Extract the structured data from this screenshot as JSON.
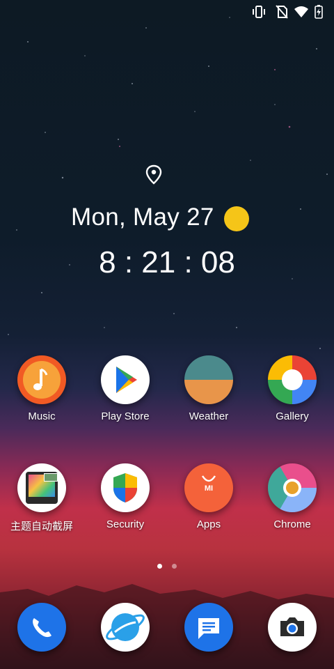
{
  "clock_widget": {
    "date": "Mon, May 27",
    "time": "8 : 21 : 08",
    "location_icon": "location-pin-icon",
    "weather_icon": "sun-icon"
  },
  "status_bar": {
    "icons": [
      "vibrate-icon",
      "no-sim-icon",
      "wifi-icon",
      "battery-charging-icon"
    ]
  },
  "apps": [
    {
      "label": "Music",
      "icon": "music-icon"
    },
    {
      "label": "Play Store",
      "icon": "play-store-icon"
    },
    {
      "label": "Weather",
      "icon": "weather-icon"
    },
    {
      "label": "Gallery",
      "icon": "gallery-icon"
    },
    {
      "label": "主题自动截屏",
      "icon": "screenshot-theme-icon"
    },
    {
      "label": "Security",
      "icon": "security-shield-icon"
    },
    {
      "label": "Apps",
      "icon": "mi-apps-icon",
      "badge_text": "MI"
    },
    {
      "label": "Chrome",
      "icon": "chrome-icon"
    }
  ],
  "page_indicator": {
    "pages": 2,
    "current": 1
  },
  "dock": [
    {
      "icon": "phone-icon"
    },
    {
      "icon": "browser-planet-icon"
    },
    {
      "icon": "messages-icon"
    },
    {
      "icon": "camera-icon"
    }
  ],
  "colors": {
    "music": "#f15a24",
    "play_store_bg": "#ffffff",
    "weather_top": "#4b8a8c",
    "weather_bottom": "#e8954a",
    "security_bg": "#ffffff",
    "apps_bg": "#f4623a",
    "phone": "#1e73e8",
    "messages": "#1e73e8",
    "sun": "#f5c518"
  }
}
